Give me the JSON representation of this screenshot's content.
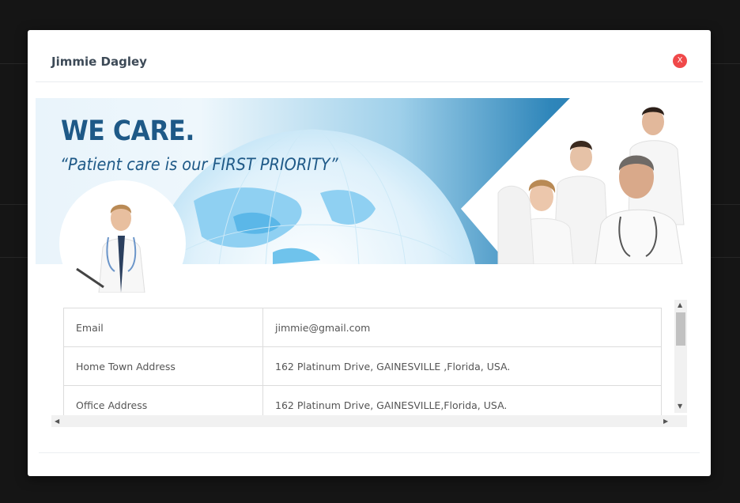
{
  "modal": {
    "title": "Jimmie Dagley",
    "close_label": "X"
  },
  "banner": {
    "heading": "WE CARE.",
    "tagline": "“Patient care is our FIRST PRIORITY”"
  },
  "details": [
    {
      "label": "Email",
      "value": "jimmie@gmail.com"
    },
    {
      "label": "Home Town Address",
      "value": "162 Platinum Drive, GAINESVILLE ,Florida, USA."
    },
    {
      "label": "Office Address",
      "value": "162 Platinum Drive, GAINESVILLE,Florida, USA."
    }
  ],
  "colors": {
    "accent": "#1e5987",
    "close": "#f0494a",
    "overlay": "#151515"
  }
}
